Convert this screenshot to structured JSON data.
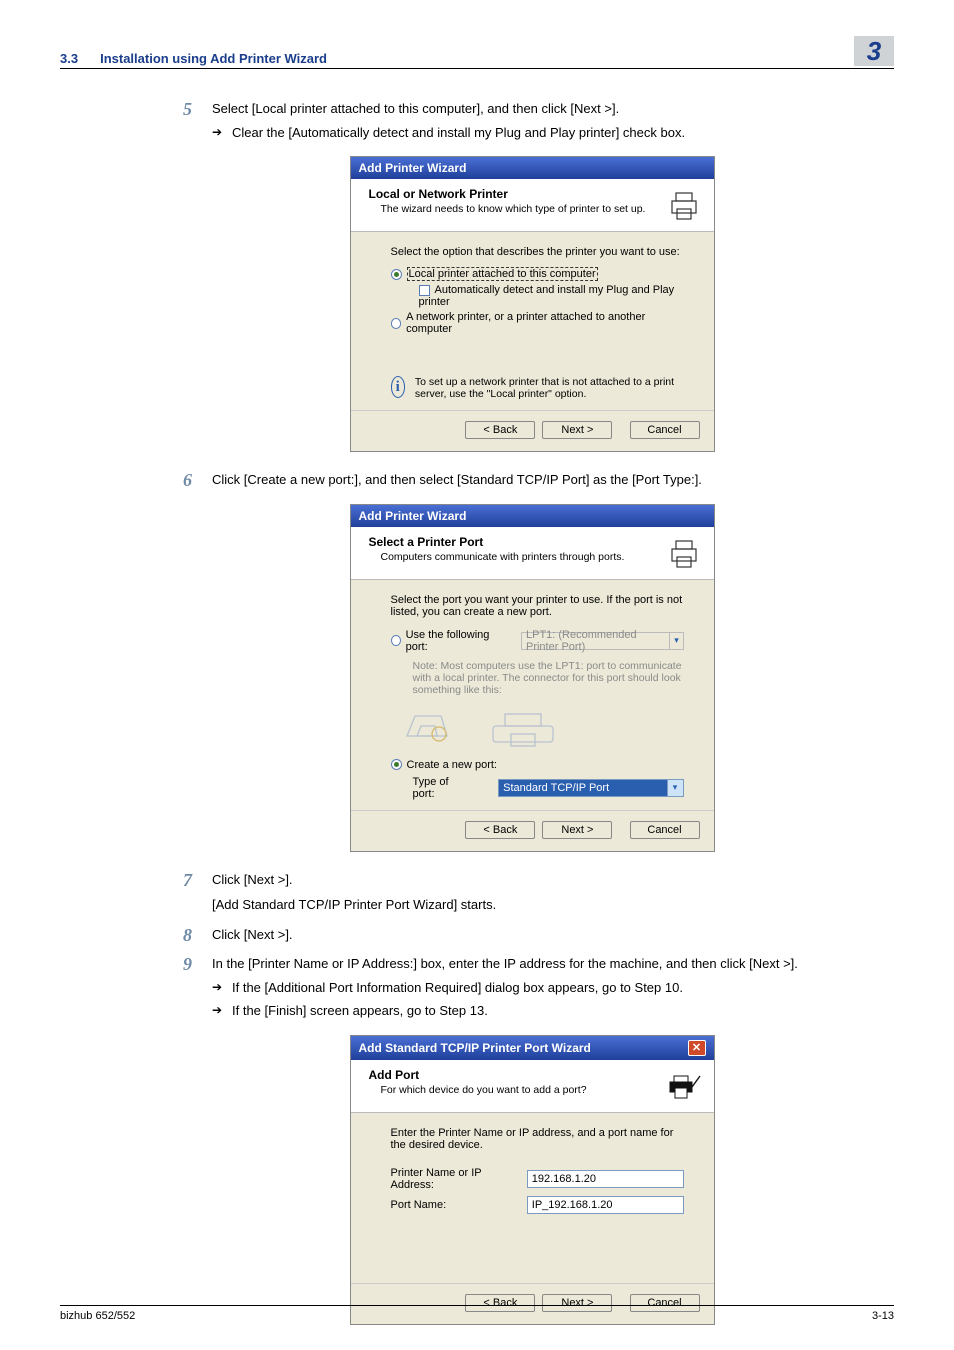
{
  "header": {
    "section_num": "3.3",
    "section_title": "Installation using Add Printer Wizard",
    "chapter_badge": "3"
  },
  "steps": {
    "s5": {
      "num": "5",
      "text": "Select [Local printer attached to this computer], and then click [Next >].",
      "arrow1": "Clear the [Automatically detect and install my Plug and Play printer] check box."
    },
    "s6": {
      "num": "6",
      "text": "Click [Create a new port:], and then select [Standard TCP/IP Port] as the [Port Type:]."
    },
    "s7": {
      "num": "7",
      "text": "Click [Next >].",
      "sub": "[Add Standard TCP/IP Printer Port Wizard] starts."
    },
    "s8": {
      "num": "8",
      "text": "Click [Next >]."
    },
    "s9": {
      "num": "9",
      "text": "In the [Printer Name or IP Address:] box, enter the IP address for the machine, and then click [Next >].",
      "arrow1": "If the [Additional Port Information Required] dialog box appears, go to Step 10.",
      "arrow2": "If the [Finish] screen appears, go to Step 13."
    }
  },
  "dlg1": {
    "title": "Add Printer Wizard",
    "head1": "Local or Network Printer",
    "head2": "The wizard needs to know which type of printer to set up.",
    "body_lead": "Select the option that describes the printer you want to use:",
    "opt1": "Local printer attached to this computer",
    "chk1": "Automatically detect and install my Plug and Play printer",
    "opt2": "A network printer, or a printer attached to another computer",
    "info": "To set up a network printer that is not attached to a print server, use the \"Local printer\" option.",
    "back": "< Back",
    "next": "Next >",
    "cancel": "Cancel"
  },
  "dlg2": {
    "title": "Add Printer Wizard",
    "head1": "Select a Printer Port",
    "head2": "Computers communicate with printers through ports.",
    "body_lead": "Select the port you want your printer to use.  If the port is not listed, you can create a new port.",
    "use_label": "Use the following port:",
    "use_value": "LPT1: (Recommended Printer Port)",
    "note": "Note: Most computers use the LPT1: port to communicate with a local printer. The connector for this port should look something like this:",
    "create_label": "Create a new port:",
    "type_label": "Type of port:",
    "type_value": "Standard TCP/IP Port",
    "back": "< Back",
    "next": "Next >",
    "cancel": "Cancel"
  },
  "dlg3": {
    "title": "Add Standard TCP/IP Printer Port Wizard",
    "head1": "Add Port",
    "head2": "For which device do you want to add a port?",
    "body_lead": "Enter the Printer Name or IP address, and a port name for the desired device.",
    "f1_label": "Printer Name or IP Address:",
    "f1_value": "192.168.1.20",
    "f2_label": "Port Name:",
    "f2_value": "IP_192.168.1.20",
    "back": "< Back",
    "next": "Next >",
    "cancel": "Cancel"
  },
  "footer": {
    "left": "bizhub 652/552",
    "right": "3-13"
  }
}
